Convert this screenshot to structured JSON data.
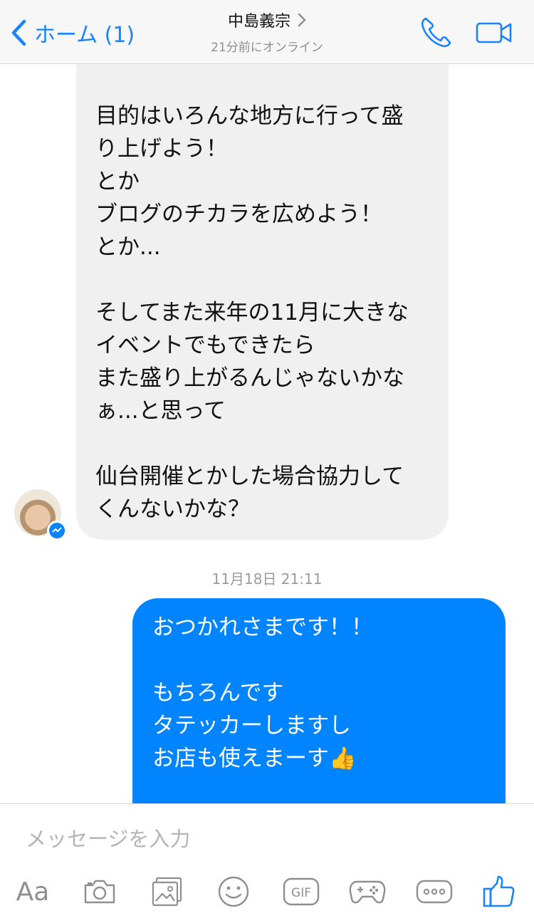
{
  "header": {
    "back_label": "ホーム (1)",
    "contact_name": "中島義宗",
    "status": "21分前にオンライン"
  },
  "messages": {
    "incoming_text": "目的はいろんな地方に行って盛\nり上げよう！\nとか\nブログのチカラを広めよう！\nとか...\n\nそしてまた来年の11月に大きな\nイベントでもできたら\nまた盛り上がるんじゃないかな\nぁ...と思って\n\n仙台開催とかした場合協力して\nくんないかな？",
    "timestamp": "11月18日 21:11",
    "outgoing_text": "おつかれさまです！！\n\nもちろんです\nタテッカーしますし\nお店も使えまーす👍"
  },
  "composer": {
    "placeholder": "メッセージを入力",
    "text_tool_label": "Aa",
    "gif_label": "GIF",
    "icons": [
      "text-format-icon",
      "camera-icon",
      "photo-icon",
      "emoji-icon",
      "gif-icon",
      "game-icon",
      "more-icon",
      "thumbs-up-icon"
    ]
  },
  "colors": {
    "accent": "#0084ff",
    "incoming_bubble": "#f0f0f0",
    "header_bg": "#f7f7f8"
  }
}
